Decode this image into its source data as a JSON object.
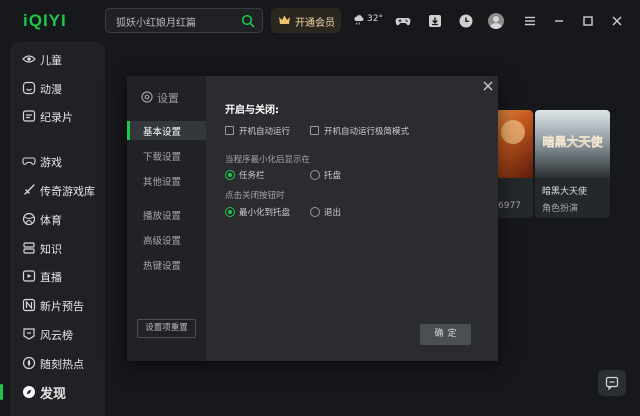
{
  "app": {
    "logo": "iQIYI"
  },
  "search": {
    "value": "狐妖小红娘月红篇"
  },
  "vip": {
    "label": "开通会员"
  },
  "weather": {
    "temp": "32°"
  },
  "sidebar": {
    "items": [
      {
        "label": "儿童",
        "icon": "eye-icon"
      },
      {
        "label": "动漫",
        "icon": "anime-icon"
      },
      {
        "label": "纪录片",
        "icon": "documentary-icon"
      },
      {
        "label": "游戏",
        "icon": "gamepad-icon"
      },
      {
        "label": "传奇游戏库",
        "icon": "sword-icon"
      },
      {
        "label": "体育",
        "icon": "ball-icon"
      },
      {
        "label": "知识",
        "icon": "book-icon"
      },
      {
        "label": "直播",
        "icon": "live-icon"
      },
      {
        "label": "新片预告",
        "icon": "new-icon"
      },
      {
        "label": "风云榜",
        "icon": "ranking-icon"
      },
      {
        "label": "随刻热点",
        "icon": "hot-icon"
      },
      {
        "label": "发现",
        "icon": "discover-icon"
      }
    ]
  },
  "cards": [
    {
      "title": "",
      "subtitle": "6977"
    },
    {
      "title": "暗黑大天使",
      "subtitle": "角色扮演",
      "art_text": "暗黑大天使"
    }
  ],
  "settings": {
    "title": "设置",
    "nav": [
      "基本设置",
      "下载设置",
      "其他设置",
      "播放设置",
      "高级设置",
      "热键设置"
    ],
    "selected": "基本设置",
    "reset_label": "设置项重置",
    "section_title": "开启与关闭:",
    "startup_options": [
      {
        "label": "开机自动运行",
        "checked": false
      },
      {
        "label": "开机自动运行极简模式",
        "checked": false
      }
    ],
    "minimize_label": "当程序最小化后显示在",
    "minimize_options": [
      {
        "label": "任务栏",
        "selected": true
      },
      {
        "label": "托盘",
        "selected": false
      }
    ],
    "close_label": "点击关闭按钮时",
    "close_options": [
      {
        "label": "最小化到托盘",
        "selected": true
      },
      {
        "label": "退出",
        "selected": false
      }
    ],
    "ok_label": "确定"
  },
  "colors": {
    "accent": "#1cc749",
    "background": "#16181b",
    "modal": "#2a2c30"
  }
}
